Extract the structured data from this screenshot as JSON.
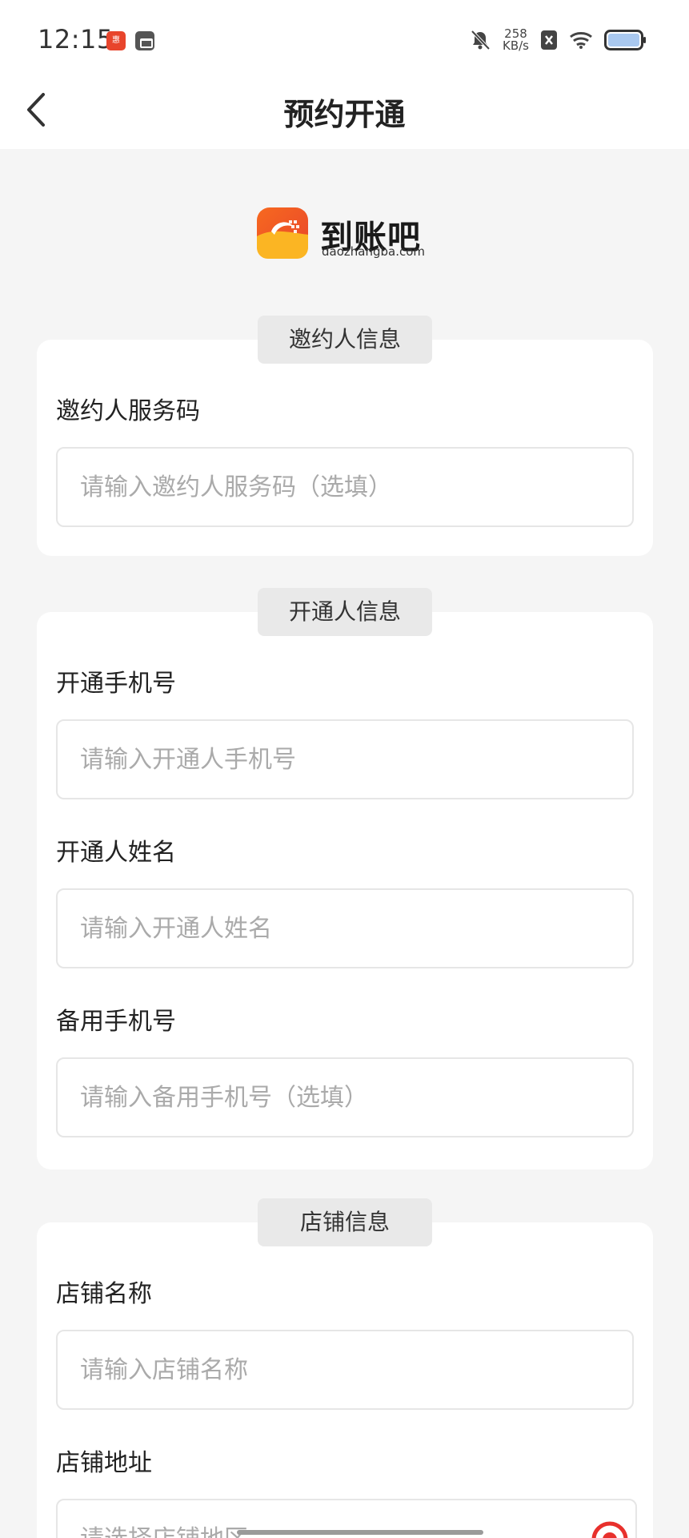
{
  "status_bar": {
    "time": "12:15",
    "network_speed_value": "258",
    "network_speed_unit": "KB/s"
  },
  "header": {
    "title": "预约开通",
    "back_icon": "chevron-left-icon"
  },
  "logo": {
    "name": "到账吧",
    "domain": "daozhangba.com",
    "colors": {
      "orange": "#f47a2a",
      "yellow": "#fbb523",
      "red": "#e8452c"
    }
  },
  "sections": {
    "inviter": {
      "tag": "邀约人信息",
      "service_code_label": "邀约人服务码",
      "service_code_placeholder": "请输入邀约人服务码（选填）"
    },
    "opener": {
      "tag": "开通人信息",
      "phone_label": "开通手机号",
      "phone_placeholder": "请输入开通人手机号",
      "name_label": "开通人姓名",
      "name_placeholder": "请输入开通人姓名",
      "backup_phone_label": "备用手机号",
      "backup_phone_placeholder": "请输入备用手机号（选填）"
    },
    "store": {
      "tag": "店铺信息",
      "store_name_label": "店铺名称",
      "store_name_placeholder": "请输入店铺名称",
      "store_address_label": "店铺地址",
      "store_address_placeholder": "请选择店铺地区",
      "location_icon": "location-pin-icon"
    }
  },
  "colors": {
    "page_background": "#f5f5f5",
    "card_background": "#ffffff",
    "tag_background": "#e9e9e9",
    "placeholder": "#aaaaaa",
    "accent_red": "#e8302c"
  }
}
